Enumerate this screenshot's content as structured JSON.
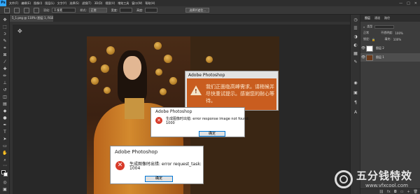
{
  "menubar": {
    "logo": "Ps",
    "items": [
      "文件(F)",
      "编辑(E)",
      "图像(I)",
      "图层(L)",
      "文字(Y)",
      "选择(S)",
      "滤镜(T)",
      "3D(D)",
      "视图(V)",
      "增效工具",
      "窗口(W)",
      "帮助(H)"
    ],
    "window_buttons": [
      "—",
      "□",
      "✕"
    ]
  },
  "options": {
    "feather_label": "羽化:",
    "feather_value": "0 像素",
    "style_label": "样式:",
    "style_value": "正常",
    "width_label": "宽度:",
    "height_label": "高度:",
    "select_mask_button": "选择并遮住..."
  },
  "document": {
    "tab_title": "5_1.png @ 110% (图层 1, RGB/8)"
  },
  "panel": {
    "tabs": [
      "图层",
      "通道",
      "路径"
    ],
    "filter_label": "类型",
    "blend_mode": "正常",
    "opacity_label": "不透明度:",
    "opacity_value": "100%",
    "lock_label": "锁定:",
    "fill_label": "填充:",
    "fill_value": "100%",
    "layers": [
      {
        "name": "图层 2",
        "visible": true,
        "active": false
      },
      {
        "name": "图层 1",
        "visible": true,
        "active": true
      }
    ]
  },
  "dialogs": {
    "warning": {
      "title": "Adobe Photoshop",
      "message": "我们正面临高峰需求。请稍候并尽快重试提示。感谢您的耐心等待。"
    },
    "error1": {
      "title": "Adobe Photoshop",
      "message": "生成图像时出错: error response image not found:",
      "code": "1000",
      "ok": "确定"
    },
    "error2": {
      "title": "Adobe Photoshop",
      "message": "生成图像时出错: error request_task:",
      "code": "1004",
      "ok": "确定"
    }
  },
  "watermark": {
    "brand": "五分钱特效",
    "url": "www.vfxcool.com"
  },
  "colors": {
    "accent": "#31a8ff",
    "error_red": "#d83b2a",
    "warning_orange": "#c95d1f",
    "ok_border": "#0078d7"
  }
}
